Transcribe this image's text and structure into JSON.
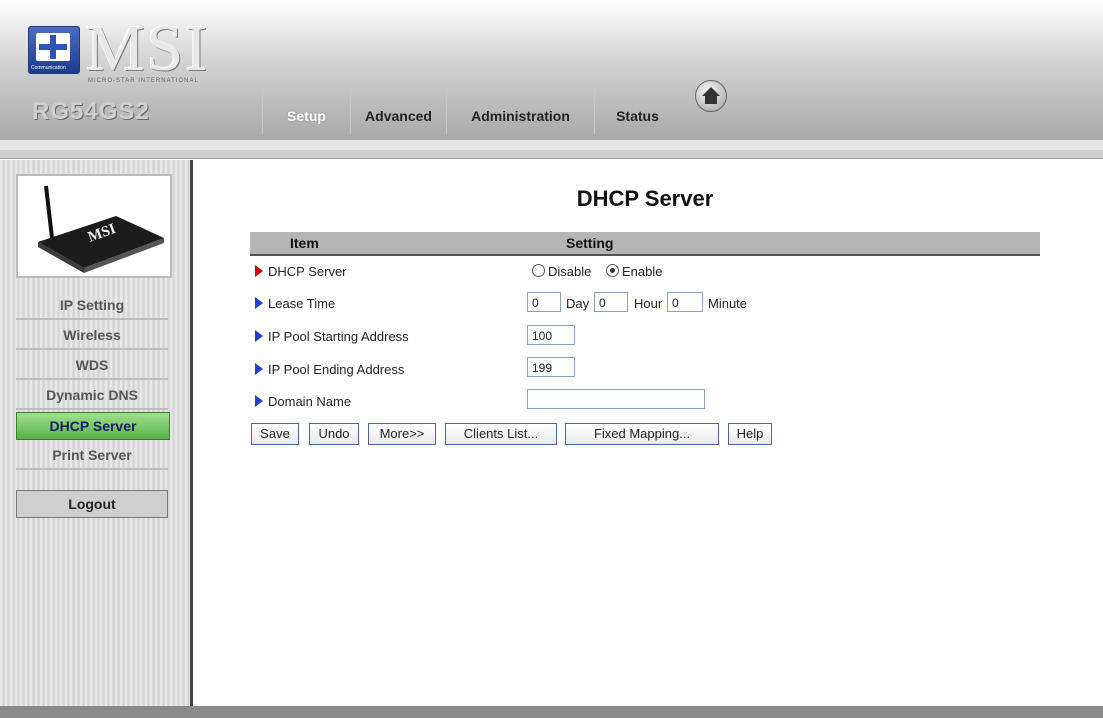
{
  "header": {
    "logo_text": "MSI",
    "logo_subtext": "MICRO-STAR INTERNATIONAL",
    "badge_text": "Communication",
    "model": "RG54GS2",
    "tabs": [
      {
        "label": "Setup",
        "active": true
      },
      {
        "label": "Advanced",
        "active": false
      },
      {
        "label": "Administration",
        "active": false
      },
      {
        "label": "Status",
        "active": false
      }
    ],
    "home_icon": "home-icon"
  },
  "sidebar": {
    "image_label": "MSI",
    "items": [
      {
        "label": "IP Setting",
        "active": false
      },
      {
        "label": "Wireless",
        "active": false
      },
      {
        "label": "WDS",
        "active": false
      },
      {
        "label": "Dynamic DNS",
        "active": false
      },
      {
        "label": "DHCP Server",
        "active": true
      },
      {
        "label": "Print Server",
        "active": false
      }
    ],
    "logout_label": "Logout",
    "active_color": "#6cc25a"
  },
  "main": {
    "title": "DHCP Server",
    "table_headers": {
      "item": "Item",
      "setting": "Setting"
    },
    "rows": {
      "dhcp_server": {
        "label": "DHCP Server",
        "options": [
          "Disable",
          "Enable"
        ],
        "selected": "Enable"
      },
      "lease_time": {
        "label": "Lease Time",
        "day_value": "0",
        "day_unit": "Day",
        "hour_value": "0",
        "hour_unit": "Hour",
        "minute_value": "0",
        "minute_unit": "Minute"
      },
      "pool_start": {
        "label": "IP Pool Starting Address",
        "value": "100"
      },
      "pool_end": {
        "label": "IP Pool Ending Address",
        "value": "199"
      },
      "domain": {
        "label": "Domain Name",
        "value": ""
      }
    },
    "buttons": {
      "save": "Save",
      "undo": "Undo",
      "more": "More>>",
      "clients": "Clients List...",
      "fixed": "Fixed Mapping...",
      "help": "Help"
    }
  }
}
